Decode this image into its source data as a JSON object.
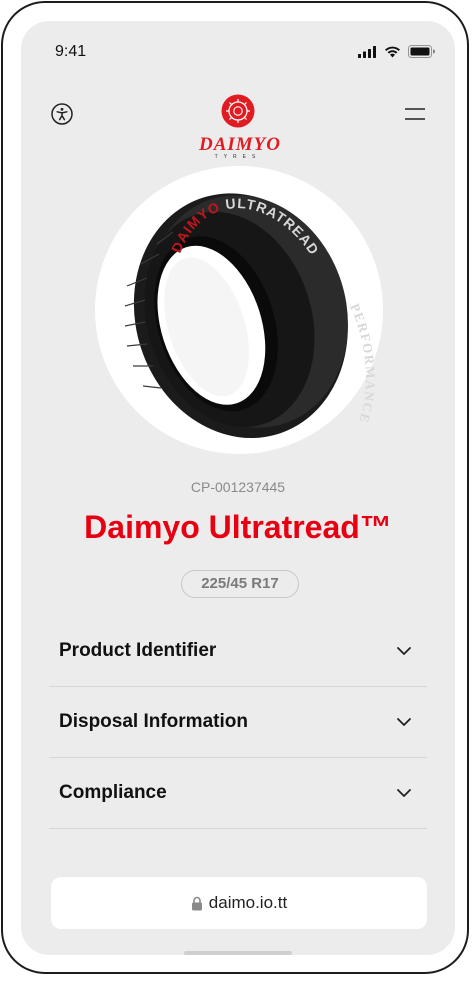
{
  "status_bar": {
    "time": "9:41"
  },
  "brand": {
    "name": "DAIMYO",
    "sub": "TYRES",
    "color": "#e11b22"
  },
  "product": {
    "code": "CP-001237445",
    "title": "Daimyo Ultratread™",
    "size": "225/45 R17",
    "tire_text": {
      "brand": "DAIMYO",
      "model": "ULTRATREAD",
      "side": "PERFORMANCE"
    }
  },
  "accordion": [
    {
      "label": "Product Identifier"
    },
    {
      "label": "Disposal Information"
    },
    {
      "label": "Compliance"
    }
  ],
  "url_bar": {
    "url": "daimo.io.tt"
  },
  "icons": [
    "accessibility-icon",
    "menu-icon",
    "chevron-down-icon",
    "lock-icon",
    "signal-icon",
    "wifi-icon",
    "battery-icon"
  ],
  "colors": {
    "accent": "#e60012",
    "background": "#ececec"
  }
}
